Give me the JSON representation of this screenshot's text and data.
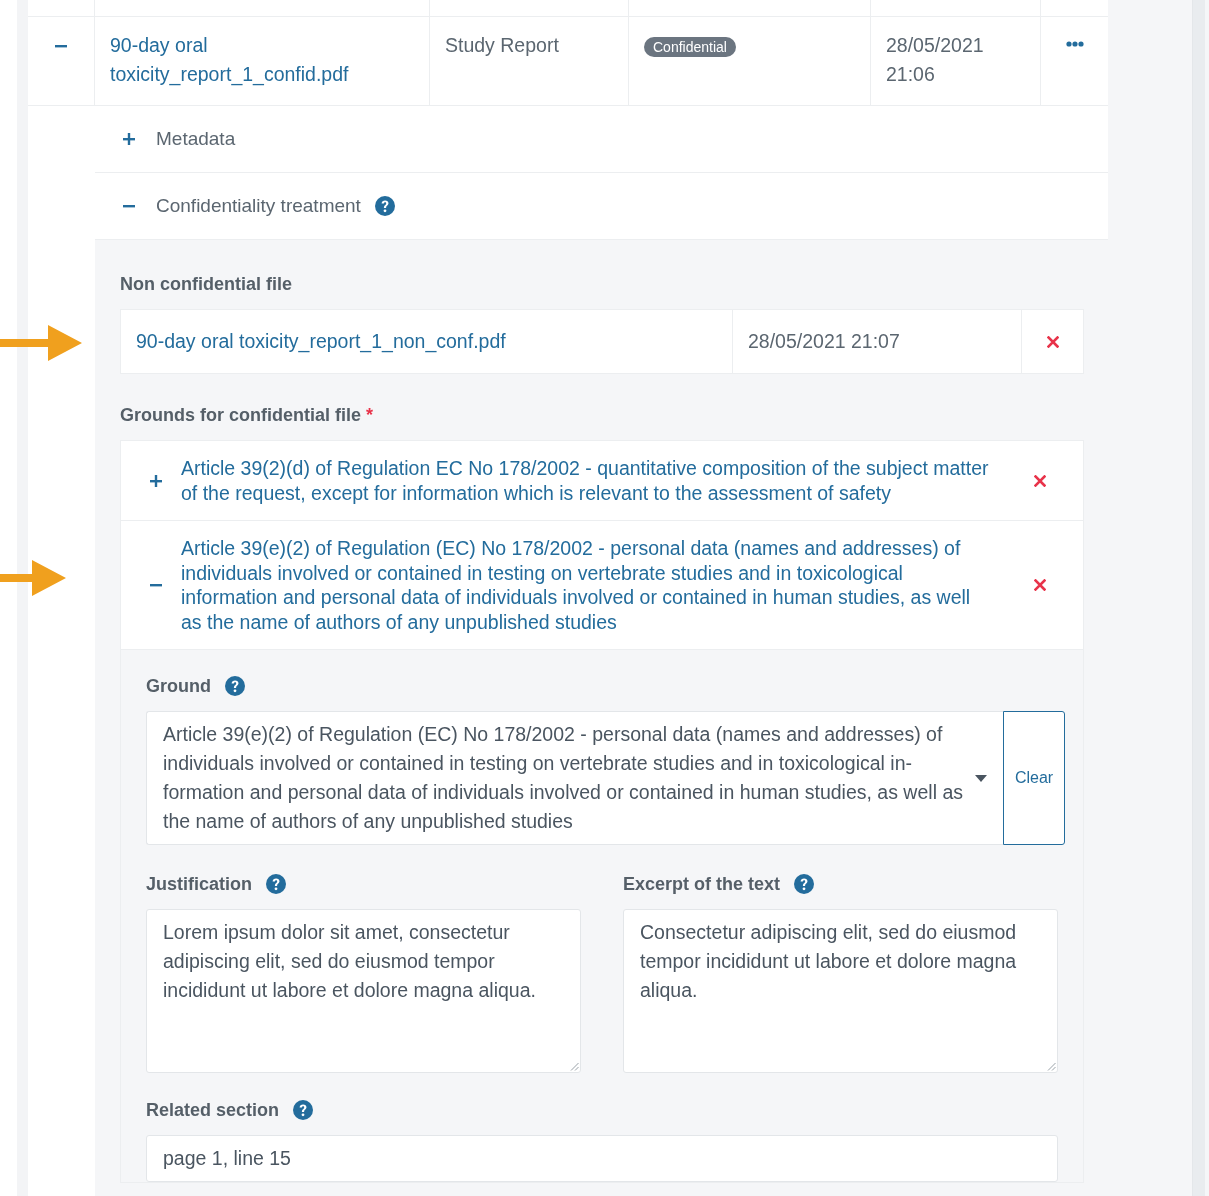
{
  "document_row": {
    "expanded": true,
    "name": "90-day oral toxicity_report_1_confid.pdf",
    "type": "Study Report",
    "badge": "Confidential",
    "date": "28/05/2021 21:06"
  },
  "sections": [
    {
      "label": "Metadata",
      "expanded": false,
      "help": false
    },
    {
      "label": "Confidentiality treatment",
      "expanded": true,
      "help": true
    }
  ],
  "non_confidential_file": {
    "heading": "Non confidential file",
    "name": "90-day oral toxicity_report_1_non_conf.pdf",
    "date": "28/05/2021 21:07"
  },
  "grounds": {
    "heading": "Grounds for confidential file",
    "required_mark": "*",
    "items": [
      {
        "text": "Article 39(2)(d) of Regulation EC No 178/2002 - quantitative composition of the subject matter of the request, except for information which is relevant to the assessment of safety",
        "expanded": false
      },
      {
        "text": "Article 39(e)(2) of Regulation (EC) No 178/2002 - personal data (names and addresses) of individuals involved or contained in testing on vertebrate studies and in toxicological information and personal data of individuals involved or contained in human studies, as well as the name of authors of any unpublished studies",
        "expanded": true
      }
    ]
  },
  "ground_form": {
    "ground": {
      "label": "Ground",
      "value": "Article 39(e)(2) of Regulation (EC) No 178/2002 - personal data (names and addresses) of individuals involved or contained in testing on vertebrate studies and in toxicological in-formation and personal data of individuals involved or contained in human studies, as well as the name of authors of any unpublished studies",
      "clear": "Clear"
    },
    "justification": {
      "label": "Justification",
      "value": "Lorem ipsum dolor sit amet, consectetur adipiscing elit, sed do eiusmod tempor incididunt ut labore et dolore magna aliqua."
    },
    "excerpt": {
      "label": "Excerpt of the text",
      "value": "Consectetur adipiscing elit, sed do eiusmod tempor incididunt ut labore et dolore magna aliqua."
    },
    "related_section": {
      "label": "Related section",
      "value": "page 1, line 15"
    }
  }
}
